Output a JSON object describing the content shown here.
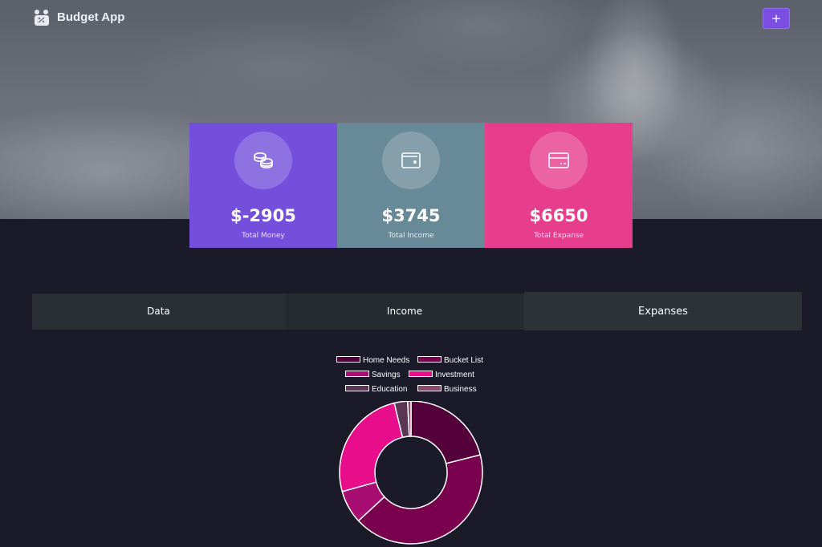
{
  "header": {
    "app_title": "Budget App",
    "add_button_label": "+",
    "logo_icon": "piggy-bank-icon"
  },
  "cards": [
    {
      "key": "money",
      "amount": "$-2905",
      "label": "Total Money",
      "icon": "coins-icon",
      "color": "#744fdb"
    },
    {
      "key": "income",
      "amount": "$3745",
      "label": "Total Income",
      "icon": "wallet-icon",
      "color": "#688997"
    },
    {
      "key": "expense",
      "amount": "$6650",
      "label": "Total Expanse",
      "icon": "credit-card-icon",
      "color": "#e63d8d"
    }
  ],
  "tabs": [
    {
      "label": "Data"
    },
    {
      "label": "Income"
    },
    {
      "label": "Expanses",
      "active": true
    }
  ],
  "chart_data": {
    "type": "pie",
    "donut": true,
    "title": "",
    "legend_position": "top",
    "categories": [
      "Home Needs",
      "Bucket List",
      "Savings",
      "Investment",
      "Education",
      "Business"
    ],
    "values": [
      1400,
      2800,
      500,
      1700,
      200,
      50
    ],
    "colors": [
      "#54003b",
      "#78004d",
      "#a80d72",
      "#e80d8a",
      "#5a3554",
      "#8a4a6e"
    ]
  }
}
